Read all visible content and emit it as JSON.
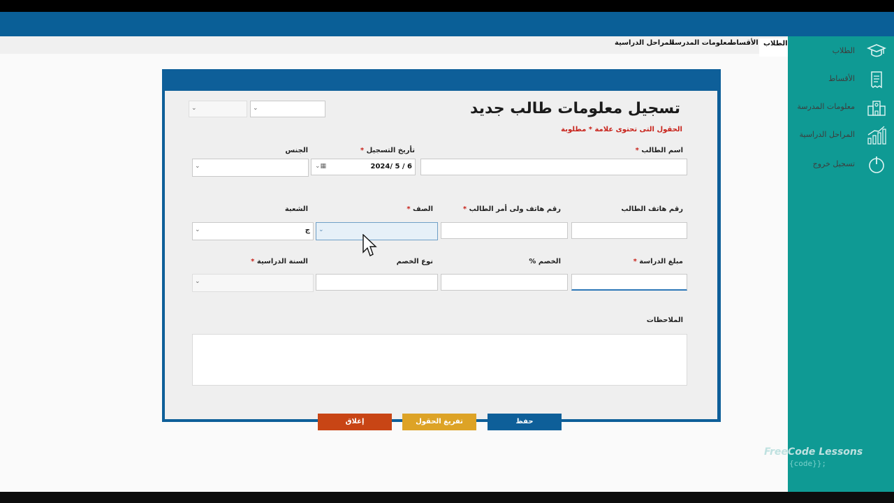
{
  "tabs": [
    {
      "label": "الطلاب",
      "active": true
    },
    {
      "label": "الأقساط",
      "active": false
    },
    {
      "label": "معلومات المدرسة",
      "active": false
    },
    {
      "label": "المراحل الدراسية",
      "active": false
    }
  ],
  "sidebar": {
    "items": [
      {
        "label": "الطلاب",
        "icon": "graduation-cap-icon"
      },
      {
        "label": "الأقساط",
        "icon": "receipt-icon"
      },
      {
        "label": "معلومات المدرسة",
        "icon": "school-building-icon"
      },
      {
        "label": "المراحل الدراسية",
        "icon": "growth-chart-icon"
      },
      {
        "label": "تسجيل خروج",
        "icon": "power-icon"
      }
    ]
  },
  "form": {
    "title": "تسجيل معلومات طالب جديد",
    "required_note_a": "الحقول التى تحتوى علامة",
    "required_note_star": "*",
    "required_note_b": "مطلوبة",
    "labels": {
      "student_name": "اسم الطالب",
      "reg_date": "تأريخ التسجيل",
      "gender": "الجنس",
      "student_phone": "رقم هاتف الطالب",
      "guardian_phone": "رقم هاتف ولى أمر الطالب",
      "class": "الصف",
      "section": "الشعبة",
      "fee": "مبلغ الدراسة",
      "discount_pct": "الخصم %",
      "discount_type": "نوع الخصم",
      "school_year": "السنة الدراسية",
      "notes": "الملاحظات"
    },
    "values": {
      "reg_date": "2024/ 5 / 6",
      "section": "ج"
    },
    "star": "*"
  },
  "buttons": {
    "save": "حفظ",
    "clear": "تفريغ الحقول",
    "close": "إغلاق"
  },
  "watermark": {
    "line1": "FreeCode Lessons",
    "line2": "{code}};"
  },
  "colors": {
    "titlebar": "#0a5f97",
    "sidebar": "#0f9a94",
    "save_button": "#0e5f99",
    "clear_button": "#dda326",
    "close_button": "#c84515",
    "required": "#c8221a"
  }
}
